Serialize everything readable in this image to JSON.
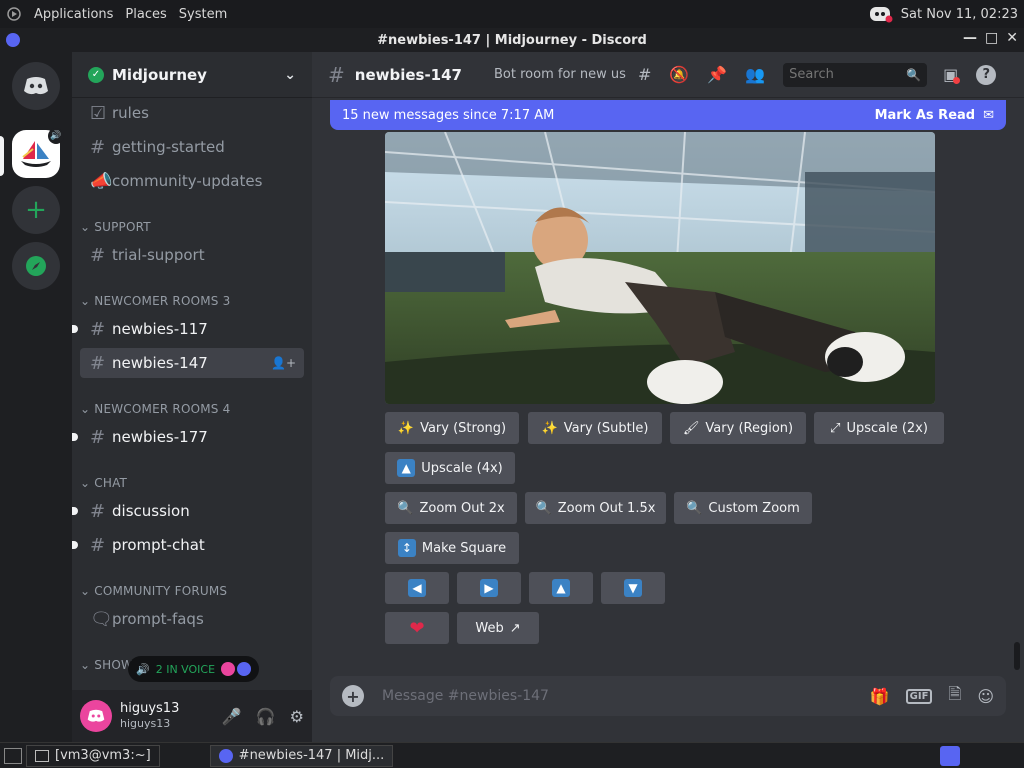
{
  "topbar": {
    "menus": [
      "Applications",
      "Places",
      "System"
    ],
    "datetime": "Sat Nov 11, 02:23"
  },
  "window": {
    "title": "#newbies-147 | Midjourney - Discord"
  },
  "guild": {
    "name": "Midjourney"
  },
  "channels": {
    "rules": "rules",
    "getting_started": "getting-started",
    "community_updates": "community-updates",
    "cat_support": "SUPPORT",
    "trial_support": "trial-support",
    "cat_newcomer3": "NEWCOMER ROOMS 3",
    "newbies_117": "newbies-117",
    "newbies_147": "newbies-147",
    "cat_newcomer4": "NEWCOMER ROOMS 4",
    "newbies_177": "newbies-177",
    "cat_chat": "CHAT",
    "discussion": "discussion",
    "prompt_chat": "prompt-chat",
    "cat_forums": "COMMUNITY FORUMS",
    "prompt_faqs": "prompt-faqs",
    "cat_show": "SHOWC",
    "voice": "2 IN VOICE"
  },
  "user": {
    "name": "higuys13",
    "tag": "higuys13"
  },
  "header": {
    "channel": "newbies-147",
    "topic": "Bot room for new us...",
    "search_placeholder": "Search"
  },
  "banner": {
    "text": "15 new messages since 7:17 AM",
    "action": "Mark As Read"
  },
  "buttons": {
    "vary_strong": "Vary (Strong)",
    "vary_subtle": "Vary (Subtle)",
    "vary_region": "Vary (Region)",
    "upscale_2x": "Upscale (2x)",
    "upscale_4x": "Upscale (4x)",
    "zoom_2x": "Zoom Out 2x",
    "zoom_15x": "Zoom Out 1.5x",
    "custom_zoom": "Custom Zoom",
    "make_square": "Make Square",
    "web": "Web"
  },
  "composer": {
    "placeholder": "Message #newbies-147",
    "gif": "GIF"
  },
  "taskbar": {
    "terminal": "[vm3@vm3:~]",
    "discord": "#newbies-147 | Midj..."
  },
  "colors": {
    "accent": "#5865f2",
    "green": "#23a55a",
    "blue_button_icon": "#3b82c4",
    "heart": "#e0284a"
  }
}
